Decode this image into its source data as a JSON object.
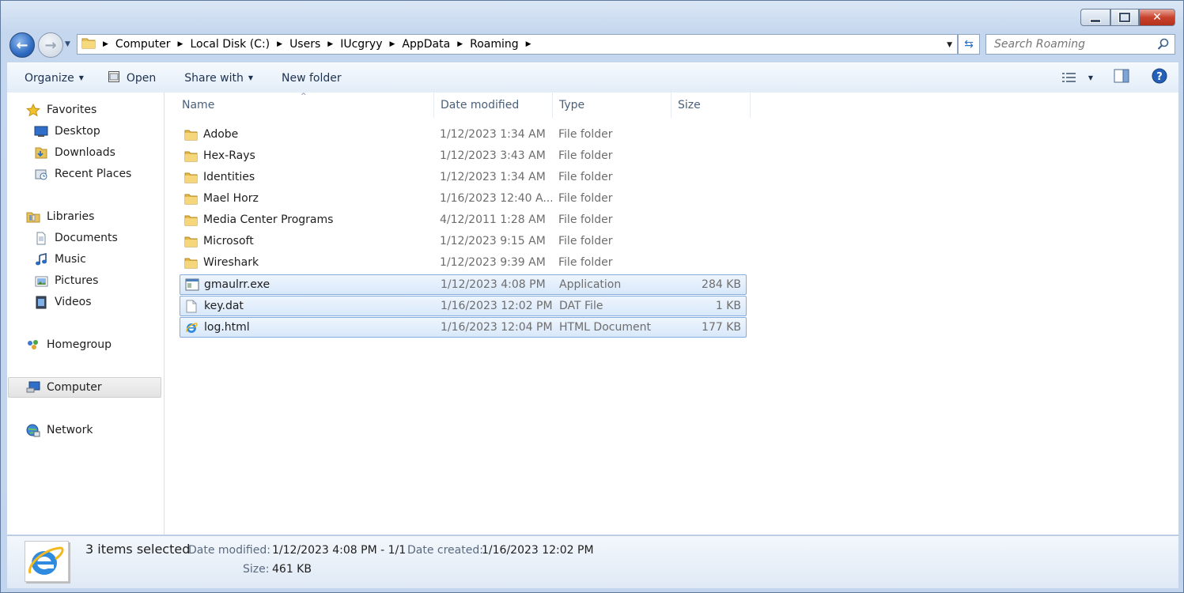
{
  "window": {
    "close_glyph": "✕"
  },
  "address_bar": {
    "breadcrumbs": [
      "Computer",
      "Local Disk (C:)",
      "Users",
      "IUcgryy",
      "AppData",
      "Roaming"
    ]
  },
  "search": {
    "placeholder": "Search Roaming"
  },
  "toolbar": {
    "organize": "Organize",
    "open": "Open",
    "share_with": "Share with",
    "new_folder": "New folder"
  },
  "navpane": {
    "favorites": "Favorites",
    "desktop": "Desktop",
    "downloads": "Downloads",
    "recent_places": "Recent Places",
    "libraries": "Libraries",
    "documents": "Documents",
    "music": "Music",
    "pictures": "Pictures",
    "videos": "Videos",
    "homegroup": "Homegroup",
    "computer": "Computer",
    "network": "Network"
  },
  "columns": {
    "name": "Name",
    "date_modified": "Date modified",
    "type": "Type",
    "size": "Size"
  },
  "files": [
    {
      "name": "Adobe",
      "date": "1/12/2023 1:34 AM",
      "type": "File folder",
      "size": "",
      "icon": "folder-icon",
      "selected": false
    },
    {
      "name": "Hex-Rays",
      "date": "1/12/2023 3:43 AM",
      "type": "File folder",
      "size": "",
      "icon": "folder-icon",
      "selected": false
    },
    {
      "name": "Identities",
      "date": "1/12/2023 1:34 AM",
      "type": "File folder",
      "size": "",
      "icon": "folder-icon",
      "selected": false
    },
    {
      "name": "Mael Horz",
      "date": "1/16/2023 12:40 A...",
      "type": "File folder",
      "size": "",
      "icon": "folder-icon",
      "selected": false
    },
    {
      "name": "Media Center Programs",
      "date": "4/12/2011 1:28 AM",
      "type": "File folder",
      "size": "",
      "icon": "folder-icon",
      "selected": false
    },
    {
      "name": "Microsoft",
      "date": "1/12/2023 9:15 AM",
      "type": "File folder",
      "size": "",
      "icon": "folder-icon",
      "selected": false
    },
    {
      "name": "Wireshark",
      "date": "1/12/2023 9:39 AM",
      "type": "File folder",
      "size": "",
      "icon": "folder-icon",
      "selected": false
    },
    {
      "name": "gmaulrr.exe",
      "date": "1/12/2023 4:08 PM",
      "type": "Application",
      "size": "284 KB",
      "icon": "application-icon",
      "selected": true
    },
    {
      "name": "key.dat",
      "date": "1/16/2023 12:02 PM",
      "type": "DAT File",
      "size": "1 KB",
      "icon": "blank-file-icon",
      "selected": true
    },
    {
      "name": "log.html",
      "date": "1/16/2023 12:04 PM",
      "type": "HTML Document",
      "size": "177 KB",
      "icon": "internet-explorer-icon",
      "selected": true
    }
  ],
  "details": {
    "selection": "3 items selected",
    "date_modified_label": "Date modified:",
    "date_modified_value": "1/12/2023 4:08 PM - 1/1...",
    "date_created_label": "Date created:",
    "date_created_value": "1/16/2023 12:02 PM",
    "size_label": "Size:",
    "size_value": "461 KB"
  },
  "colors": {
    "selection_bg": "#d8e8fa",
    "selection_border": "#84acdd",
    "chrome_bg": "#c2d5ec"
  }
}
